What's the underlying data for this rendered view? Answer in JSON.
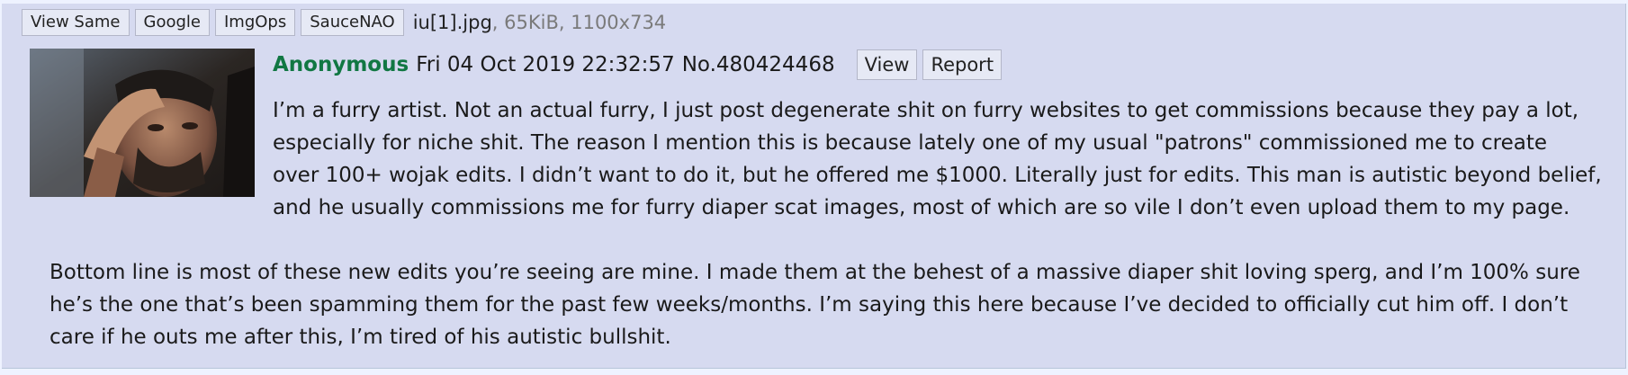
{
  "file": {
    "buttons": [
      "View Same",
      "Google",
      "ImgOps",
      "SauceNAO"
    ],
    "filename": "iu[1].jpg",
    "meta": ", 65KiB, 1100x734"
  },
  "post": {
    "name": "Anonymous",
    "datetime": "Fri 04 Oct 2019 22:32:57",
    "number": "No.480424468",
    "view_label": "View",
    "report_label": "Report",
    "paragraph1": [
      "I’m a furry artist. Not an actual furry, I just post degenerate shit on furry websites to get commissions because they pay a lot,",
      "especially for niche shit. The reason I mention this is because lately one of my usual \"patrons\" commissioned me to create",
      "over 100+ wojak edits. I didn’t want to do it, but he offered me $1000. Literally just for edits. This man is autistic beyond belief,",
      "and he usually commissions me for furry diaper scat images, most of which are so vile I don’t even upload them to my page."
    ],
    "paragraph2": [
      "Bottom line is most of these new edits you’re seeing are mine. I made them at the behest of a massive diaper shit loving sperg, and I’m 100% sure",
      "he’s the one that’s been spamming them for the past few weeks/months. I’m saying this here because I’ve decided to officially cut him off. I don’t",
      "care if he outs me after this, I’m tired of his autistic bullshit."
    ]
  },
  "colors": {
    "post_bg": "#d6daf0",
    "name": "#117743",
    "meta": "#7a7a7a"
  },
  "icons": {
    "thumbnail": "distressed-man-photo"
  }
}
